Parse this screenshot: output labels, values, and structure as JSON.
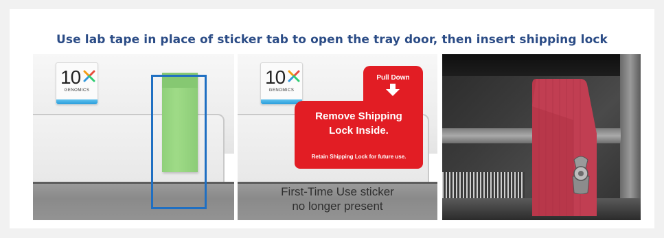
{
  "title": "Use lab tape in place of sticker tab to open the tray door, then insert shipping lock",
  "logo": {
    "mark": "10",
    "sub": "GENOMICS"
  },
  "sticker": {
    "pull_label": "Pull Down",
    "main_line1": "Remove Shipping",
    "main_line2": "Lock Inside.",
    "small": "Retain Shipping Lock for future use."
  },
  "caption": {
    "line1": "First-Time Use sticker",
    "line2": "no longer present"
  },
  "colors": {
    "title": "#2b4c86",
    "highlight_box": "#1f6fc2",
    "tape": "#9fdb87",
    "sticker_red": "#e21d24",
    "shipping_lock_red": "#b8374a"
  }
}
